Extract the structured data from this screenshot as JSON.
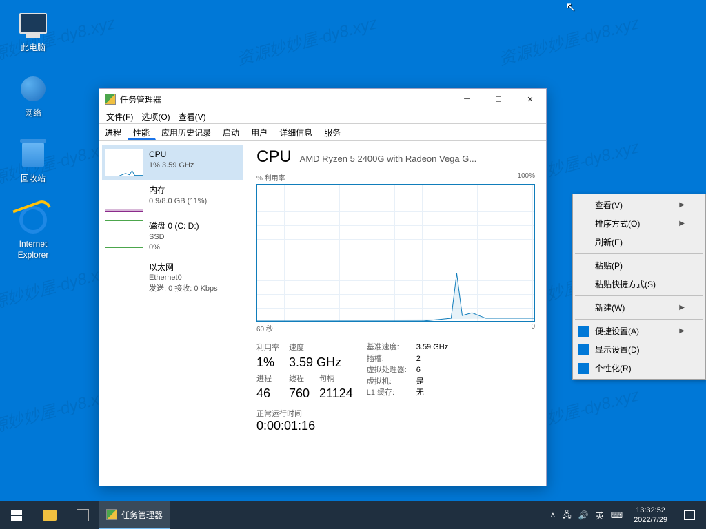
{
  "desktop_icons": {
    "this_pc": "此电脑",
    "network": "网络",
    "recycle_bin": "回收站",
    "ie": "Internet Explorer"
  },
  "window": {
    "title": "任务管理器",
    "menu": {
      "file": "文件(F)",
      "options": "选项(O)",
      "view": "查看(V)"
    },
    "tabs": {
      "processes": "进程",
      "performance": "性能",
      "apphistory": "应用历史记录",
      "startup": "启动",
      "users": "用户",
      "details": "详细信息",
      "services": "服务"
    },
    "sidebar": {
      "cpu": {
        "name": "CPU",
        "val": "1% 3.59 GHz"
      },
      "mem": {
        "name": "内存",
        "val": "0.9/8.0 GB (11%)"
      },
      "disk": {
        "name": "磁盘 0 (C: D:)",
        "sub": "SSD",
        "val": "0%"
      },
      "net": {
        "name": "以太网",
        "sub": "Ethernet0",
        "val": "发送: 0 接收: 0 Kbps"
      }
    },
    "main": {
      "title": "CPU",
      "subtitle": "AMD Ryzen 5 2400G with Radeon Vega G...",
      "chart_top_left": "% 利用率",
      "chart_top_right": "100%",
      "chart_bottom_left": "60 秒",
      "chart_bottom_right": "0",
      "stats": {
        "util_lbl": "利用率",
        "util_val": "1%",
        "speed_lbl": "速度",
        "speed_val": "3.59 GHz",
        "proc_lbl": "进程",
        "proc_val": "46",
        "thread_lbl": "线程",
        "thread_val": "760",
        "handle_lbl": "句柄",
        "handle_val": "21124",
        "base_lbl": "基准速度:",
        "base_val": "3.59 GHz",
        "sockets_lbl": "插槽:",
        "sockets_val": "2",
        "vproc_lbl": "虚拟处理器:",
        "vproc_val": "6",
        "vm_lbl": "虚拟机:",
        "vm_val": "是",
        "l1_lbl": "L1 缓存:",
        "l1_val": "无",
        "uptime_lbl": "正常运行时间",
        "uptime_val": "0:00:01:16"
      }
    }
  },
  "context_menu": {
    "view": "查看(V)",
    "sort": "排序方式(O)",
    "refresh": "刷新(E)",
    "paste": "粘贴(P)",
    "paste_shortcut": "粘贴快捷方式(S)",
    "new": "新建(W)",
    "quick_settings": "便捷设置(A)",
    "display_settings": "显示设置(D)",
    "personalize": "个性化(R)"
  },
  "taskbar": {
    "task_label": "任务管理器",
    "ime": "英",
    "clock_time": "13:32:52",
    "clock_date": "2022/7/29"
  },
  "watermark_text": "资源妙妙屋-dy8.xyz",
  "chart_data": {
    "type": "line",
    "title": "CPU % 利用率",
    "xlabel": "秒",
    "ylabel": "%",
    "x_range_seconds": [
      60,
      0
    ],
    "ylim": [
      0,
      100
    ],
    "series": [
      {
        "name": "CPU",
        "values_pct_recent_to_old": [
          2,
          2,
          1,
          2,
          2,
          6,
          35,
          4,
          2,
          1,
          1,
          1,
          1,
          1,
          1,
          0,
          0,
          0,
          0,
          0,
          0,
          0,
          0,
          0,
          0,
          0,
          0,
          0,
          0,
          0,
          0,
          0,
          0,
          0,
          0,
          0,
          0,
          0,
          0,
          0,
          0,
          0,
          0,
          0,
          0,
          0,
          0,
          0,
          0,
          0,
          0,
          0,
          0,
          0,
          0,
          0,
          0,
          0,
          0,
          0
        ]
      }
    ]
  }
}
